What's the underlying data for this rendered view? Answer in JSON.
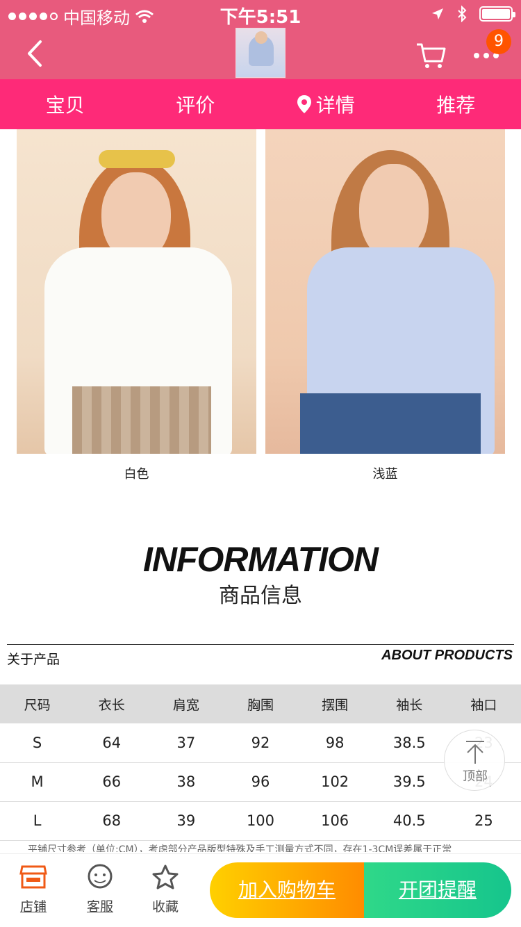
{
  "status_bar": {
    "carrier": "中国移动",
    "time": "下午5:51"
  },
  "nav": {
    "cart_badge": "9"
  },
  "tabs": [
    {
      "label": "宝贝"
    },
    {
      "label": "评价"
    },
    {
      "label": "详情"
    },
    {
      "label": "推荐"
    }
  ],
  "colors": {
    "title": "白色",
    "blue": "浅蓝"
  },
  "info": {
    "title": "INFORMATION",
    "subtitle": "商品信息",
    "about_cn": "关于产品",
    "about_en": "ABOUT PRODUCTS"
  },
  "size_table": {
    "headers": [
      "尺码",
      "衣长",
      "肩宽",
      "胸围",
      "摆围",
      "袖长",
      "袖口"
    ],
    "rows": [
      [
        "S",
        "64",
        "37",
        "92",
        "98",
        "38.5",
        "23"
      ],
      [
        "M",
        "66",
        "38",
        "96",
        "102",
        "39.5",
        "24"
      ],
      [
        "L",
        "68",
        "39",
        "100",
        "106",
        "40.5",
        "25"
      ]
    ],
    "note": "平铺尺寸参考（单位:CM），考虑部分产品版型特殊及手工测量方式不同，存在1-3CM误差属于正常"
  },
  "to_top": {
    "label": "顶部"
  },
  "bottom_bar": {
    "store": "店铺",
    "service": "客服",
    "favorite": "收藏",
    "add_cart": "加入购物车",
    "remind": "开团提醒"
  },
  "theme": {
    "nav_pink": "#e85a7d",
    "tab_pink": "#fe2a78",
    "badge_orange": "#ff5400",
    "icon_orange": "#f05a16"
  }
}
